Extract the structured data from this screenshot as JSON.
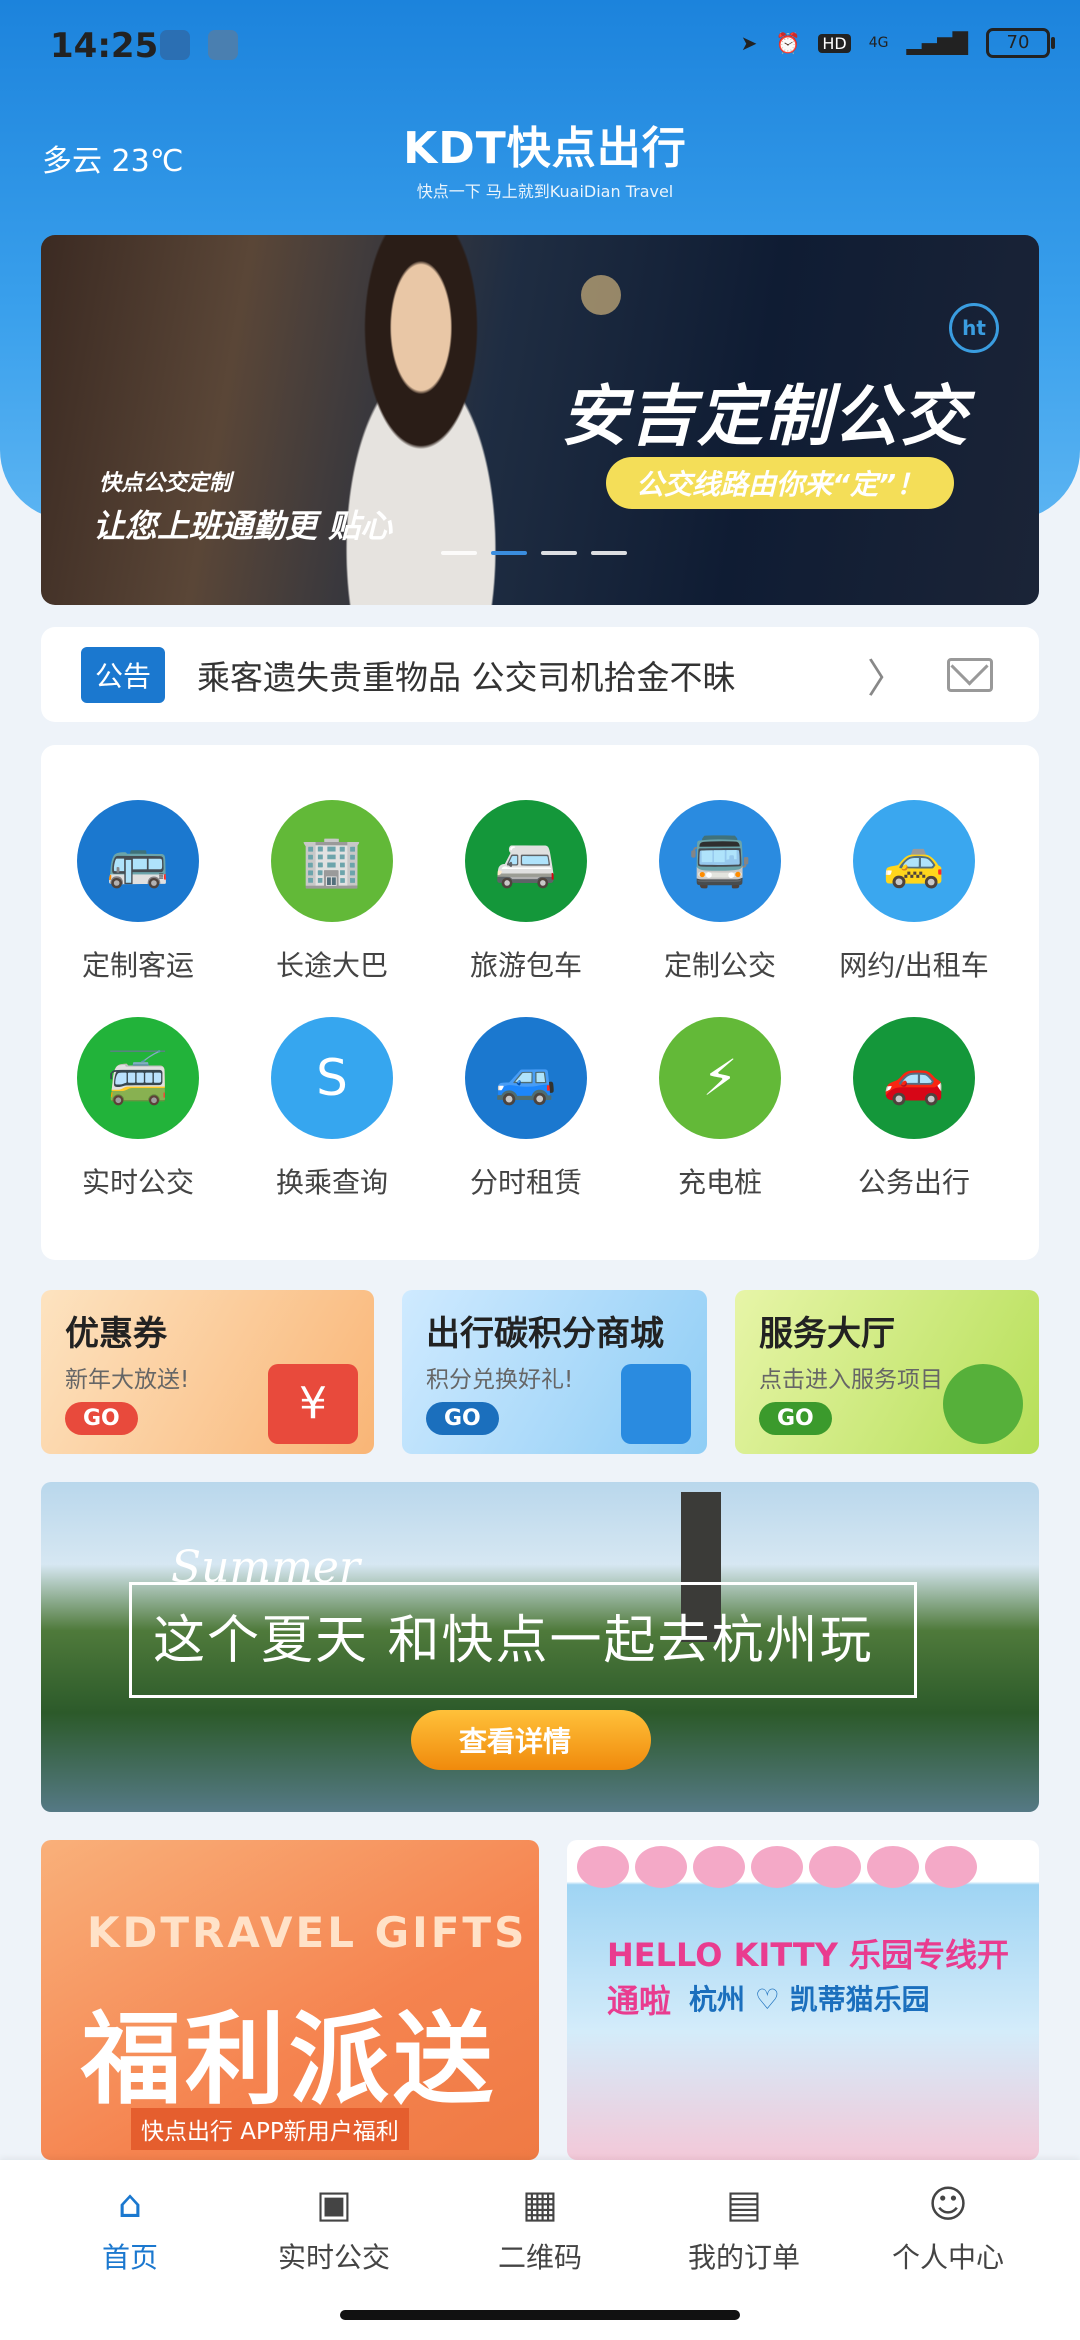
{
  "status_bar": {
    "time": "14:25",
    "battery": "70",
    "network": "4G"
  },
  "header": {
    "weather": "多云 23℃",
    "logo_title": "KDT快点出行",
    "logo_slogan": "快点一下 马上就到KuaiDian Travel"
  },
  "banner": {
    "headline": "安吉定制公交",
    "pill": "公交线路由你来“定”！",
    "sub1": "快点公交定制",
    "sub2": "让您上班通勤更 贴心",
    "badge": "ht"
  },
  "notice": {
    "tag": "公告",
    "text": "乘客遗失贵重物品 公交司机拾金不昧"
  },
  "services": [
    {
      "label": "定制客运",
      "icon": "bus-icon",
      "color": "#1b78cf"
    },
    {
      "label": "长途大巴",
      "icon": "building-icon",
      "color": "#62b938"
    },
    {
      "label": "旅游包车",
      "icon": "van-icon",
      "color": "#14973a"
    },
    {
      "label": "定制公交",
      "icon": "bus-front-icon",
      "color": "#2a8be0"
    },
    {
      "label": "网约/出租车",
      "icon": "taxi-icon",
      "color": "#3aa7ef"
    },
    {
      "label": "实时公交",
      "icon": "realtime-bus-icon",
      "color": "#22b33a"
    },
    {
      "label": "换乘查询",
      "icon": "route-icon",
      "color": "#36a6ef"
    },
    {
      "label": "分时租赁",
      "icon": "car-rental-icon",
      "color": "#1b78cf"
    },
    {
      "label": "充电桩",
      "icon": "charging-icon",
      "color": "#63b938"
    },
    {
      "label": "公务出行",
      "icon": "car-icon",
      "color": "#14973a"
    }
  ],
  "promos": {
    "coupon": {
      "title": "优惠券",
      "subtitle": "新年大放送!",
      "go": "GO",
      "symbol": "¥"
    },
    "carbon": {
      "title": "出行碳积分商城",
      "subtitle": "积分兑换好礼!",
      "go": "GO"
    },
    "service": {
      "title": "服务大厅",
      "subtitle": "点击进入服务项目",
      "go": "GO"
    }
  },
  "summer": {
    "script": "Summer",
    "title": "这个夏天 和快点一起去杭州玩",
    "button": "查看详情"
  },
  "gifts": {
    "english": "KDTRAVEL GIFTS",
    "big": "福利派送",
    "sub": "快点出行 APP新用户福利"
  },
  "kitty": {
    "title": "HELLO KITTY 乐园专线开通啦",
    "subtitle": "杭州 ♡ 凯蒂猫乐园"
  },
  "tabbar": [
    {
      "label": "首页",
      "icon": "home-icon",
      "active": true
    },
    {
      "label": "实时公交",
      "icon": "bus-tab-icon",
      "active": false
    },
    {
      "label": "二维码",
      "icon": "qr-icon",
      "active": false
    },
    {
      "label": "我的订单",
      "icon": "order-icon",
      "active": false
    },
    {
      "label": "个人中心",
      "icon": "person-icon",
      "active": false
    }
  ]
}
